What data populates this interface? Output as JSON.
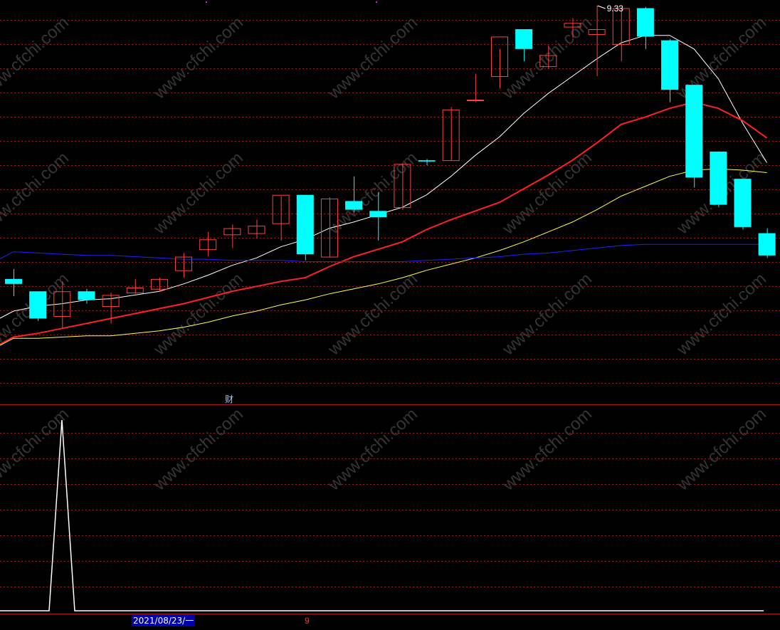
{
  "app": {
    "top_marker_color": "#ff00ff"
  },
  "main_panel": {
    "peak_label": "9.33",
    "finance_label": "财",
    "colors": {
      "up": "#ff4040",
      "down": "#00ffff",
      "ma5": "#ffffff",
      "ma10": "#ff2020",
      "ma20": "#ffff40",
      "ma60": "#2020ff",
      "grid": "#a01818"
    }
  },
  "sub_panel": {
    "line_color": "#ffffff"
  },
  "status": {
    "date": "2021/08/23/一",
    "cursor_value": "9"
  },
  "chart_data": [
    {
      "type": "candlestick",
      "price_range": [
        4.7,
        9.38
      ],
      "grid": true,
      "peak_label": "9.33",
      "candles": [
        {
          "o": 7.12,
          "h": 7.2,
          "l": 6.98,
          "c": 7.08
        },
        {
          "o": 7.02,
          "h": 7.02,
          "l": 6.78,
          "c": 6.8
        },
        {
          "o": 6.82,
          "h": 7.1,
          "l": 6.72,
          "c": 7.02
        },
        {
          "o": 7.02,
          "h": 7.04,
          "l": 6.92,
          "c": 6.95
        },
        {
          "o": 6.9,
          "h": 7.01,
          "l": 6.76,
          "c": 6.99
        },
        {
          "o": 7.01,
          "h": 7.12,
          "l": 7.0,
          "c": 7.05
        },
        {
          "o": 7.04,
          "h": 7.13,
          "l": 7.02,
          "c": 7.12
        },
        {
          "o": 7.19,
          "h": 7.33,
          "l": 7.13,
          "c": 7.3
        },
        {
          "o": 7.36,
          "h": 7.5,
          "l": 7.3,
          "c": 7.44
        },
        {
          "o": 7.48,
          "h": 7.56,
          "l": 7.37,
          "c": 7.53
        },
        {
          "o": 7.49,
          "h": 7.6,
          "l": 7.45,
          "c": 7.55
        },
        {
          "o": 7.57,
          "h": 7.79,
          "l": 7.43,
          "c": 7.8
        },
        {
          "o": 7.8,
          "h": 7.8,
          "l": 7.27,
          "c": 7.32
        },
        {
          "o": 7.3,
          "h": 7.78,
          "l": 7.3,
          "c": 7.77
        },
        {
          "o": 7.75,
          "h": 7.95,
          "l": 7.66,
          "c": 7.68
        },
        {
          "o": 7.67,
          "h": 7.82,
          "l": 7.43,
          "c": 7.62
        },
        {
          "o": 7.7,
          "h": 8.06,
          "l": 7.68,
          "c": 8.05
        },
        {
          "o": 8.08,
          "h": 8.09,
          "l": 8.04,
          "c": 8.07
        },
        {
          "o": 8.08,
          "h": 8.51,
          "l": 8.08,
          "c": 8.49
        },
        {
          "o": 8.57,
          "h": 8.78,
          "l": 8.55,
          "c": 8.57
        },
        {
          "o": 8.76,
          "h": 8.98,
          "l": 8.66,
          "c": 9.08
        },
        {
          "o": 9.14,
          "h": 9.14,
          "l": 8.88,
          "c": 8.98
        },
        {
          "o": 8.84,
          "h": 9.01,
          "l": 8.82,
          "c": 8.93
        },
        {
          "o": 9.16,
          "h": 9.23,
          "l": 9.07,
          "c": 9.19
        },
        {
          "o": 9.1,
          "h": 9.33,
          "l": 8.76,
          "c": 9.14
        },
        {
          "o": 9.02,
          "h": 9.31,
          "l": 8.88,
          "c": 9.31
        },
        {
          "o": 9.31,
          "h": 9.32,
          "l": 8.98,
          "c": 9.08
        },
        {
          "o": 9.05,
          "h": 9.06,
          "l": 8.55,
          "c": 8.65
        },
        {
          "o": 8.69,
          "h": 8.69,
          "l": 7.86,
          "c": 7.94
        },
        {
          "o": 8.15,
          "h": 8.15,
          "l": 7.7,
          "c": 7.72
        },
        {
          "o": 7.93,
          "h": 7.93,
          "l": 7.52,
          "c": 7.54
        },
        {
          "o": 7.49,
          "h": 7.53,
          "l": 7.29,
          "c": 7.31
        }
      ],
      "ma_series": [
        {
          "color": "#ffffff",
          "values": [
            6.86,
            6.9,
            6.92,
            6.95,
            6.96,
            6.99,
            7.02,
            7.08,
            7.15,
            7.23,
            7.29,
            7.38,
            7.44,
            7.53,
            7.58,
            7.64,
            7.7,
            7.8,
            7.95,
            8.12,
            8.27,
            8.46,
            8.62,
            8.76,
            8.9,
            9.03,
            9.09,
            9.09,
            8.98,
            8.74,
            8.38,
            8.06
          ]
        },
        {
          "color": "#ff2020",
          "values": [
            6.65,
            6.68,
            6.72,
            6.76,
            6.8,
            6.84,
            6.88,
            6.92,
            6.97,
            7.02,
            7.06,
            7.1,
            7.13,
            7.22,
            7.3,
            7.36,
            7.42,
            7.52,
            7.6,
            7.67,
            7.74,
            7.85,
            7.96,
            8.08,
            8.22,
            8.37,
            8.43,
            8.5,
            8.55,
            8.5,
            8.4,
            8.26
          ]
        },
        {
          "color": "#ffff40",
          "values": [
            6.64,
            6.64,
            6.65,
            6.66,
            6.66,
            6.68,
            6.7,
            6.73,
            6.77,
            6.82,
            6.86,
            6.91,
            6.95,
            7.0,
            7.04,
            7.08,
            7.13,
            7.19,
            7.24,
            7.29,
            7.35,
            7.42,
            7.5,
            7.58,
            7.68,
            7.79,
            7.87,
            7.95,
            8.0,
            8.01,
            8.0,
            7.98
          ]
        },
        {
          "color": "#2020ff",
          "values": [
            7.34,
            7.33,
            7.32,
            7.31,
            7.31,
            7.3,
            7.29,
            7.28,
            7.28,
            7.27,
            7.27,
            7.27,
            7.26,
            7.26,
            7.26,
            7.26,
            7.26,
            7.27,
            7.28,
            7.29,
            7.3,
            7.32,
            7.33,
            7.35,
            7.37,
            7.39,
            7.4,
            7.4,
            7.4,
            7.4,
            7.4,
            7.4
          ]
        }
      ]
    },
    {
      "type": "line",
      "ylim": [
        0,
        1
      ],
      "grid": true,
      "x": [
        0,
        1.47,
        2,
        2.53,
        3,
        31
      ],
      "values": [
        0,
        0,
        1,
        0,
        0,
        0
      ]
    }
  ]
}
